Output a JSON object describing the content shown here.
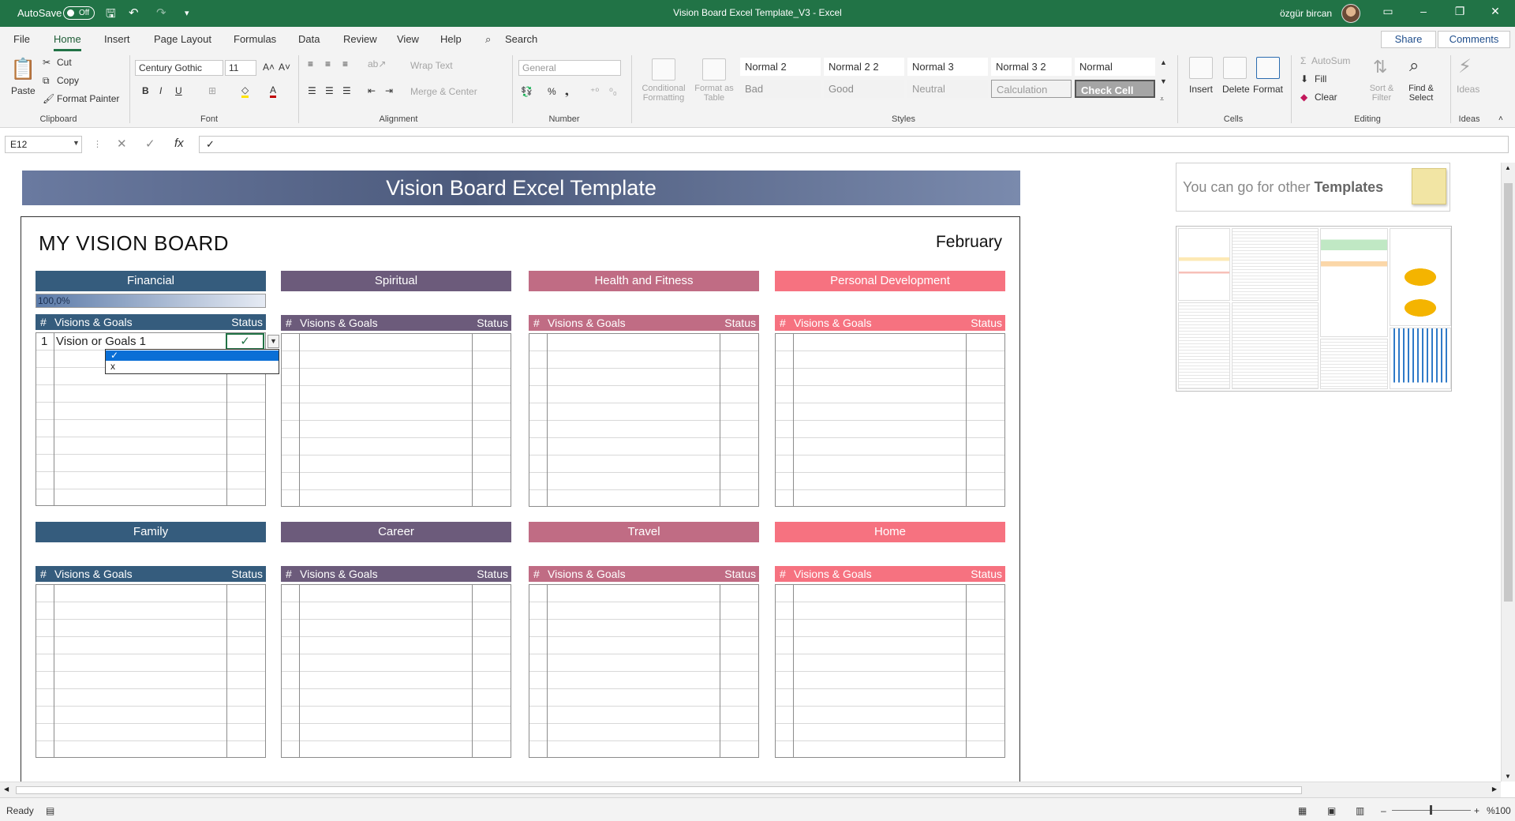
{
  "title_bar": {
    "autosave_label": "AutoSave",
    "autosave_state": "Off",
    "document_title": "Vision Board Excel Template_V3  -  Excel",
    "user_name": "özgür bircan"
  },
  "ribbon_tabs": [
    "File",
    "Home",
    "Insert",
    "Page Layout",
    "Formulas",
    "Data",
    "Review",
    "View",
    "Help"
  ],
  "search_label": "Search",
  "share_label": "Share",
  "comments_label": "Comments",
  "ribbon": {
    "clipboard": {
      "paste": "Paste",
      "cut": "Cut",
      "copy": "Copy",
      "format_painter": "Format Painter",
      "label": "Clipboard"
    },
    "font": {
      "name": "Century Gothic",
      "size": "11",
      "label": "Font"
    },
    "alignment": {
      "wrap_text": "Wrap Text",
      "merge_center": "Merge & Center",
      "label": "Alignment"
    },
    "number": {
      "format": "General",
      "label": "Number"
    },
    "styles": {
      "conditional": "Conditional Formatting",
      "format_as_table": "Format as Table",
      "cells": [
        {
          "name": "Normal 2",
          "bg": "#ffffff",
          "color": "#333333"
        },
        {
          "name": "Normal 2 2",
          "bg": "#ffffff",
          "color": "#333333"
        },
        {
          "name": "Normal 3",
          "bg": "#ffffff",
          "color": "#333333"
        },
        {
          "name": "Normal 3 2",
          "bg": "#ffffff",
          "color": "#333333"
        },
        {
          "name": "Normal",
          "bg": "#ffffff",
          "color": "#333333"
        },
        {
          "name": "Bad",
          "bg": "#f2f2f2",
          "color": "#8a8a8a"
        },
        {
          "name": "Good",
          "bg": "#f2f2f2",
          "color": "#8a8a8a"
        },
        {
          "name": "Neutral",
          "bg": "#f2f2f2",
          "color": "#9a9a9a"
        },
        {
          "name": "Calculation",
          "bg": "#f2f2f2",
          "color": "#9a9a9a"
        },
        {
          "name": "Check Cell",
          "bg": "#a5a5a5",
          "color": "#ffffff"
        }
      ],
      "label": "Styles"
    },
    "cells": {
      "insert": "Insert",
      "delete": "Delete",
      "format": "Format",
      "label": "Cells"
    },
    "editing": {
      "autosum": "AutoSum",
      "fill": "Fill",
      "clear": "Clear",
      "sort_filter": "Sort & Filter",
      "find_select": "Find & Select",
      "label": "Editing"
    },
    "ideas": {
      "ideas": "Ideas",
      "label": "Ideas"
    }
  },
  "formula_bar": {
    "name_box": "E12",
    "value": "✓"
  },
  "sheet": {
    "banner": "Vision Board Excel Template",
    "board_title": "MY VISION BOARD",
    "month": "February",
    "other_templates_prefix": "You can go for other ",
    "other_templates_bold": "Templates",
    "categories": [
      {
        "name": "Financial",
        "color": "#355c7d",
        "progress": "100,0%"
      },
      {
        "name": "Spiritual",
        "color": "#6c5b7b"
      },
      {
        "name": "Health and Fitness",
        "color": "#c06c84"
      },
      {
        "name": "Personal Development",
        "color": "#f67280"
      },
      {
        "name": "Family",
        "color": "#355c7d"
      },
      {
        "name": "Career",
        "color": "#6c5b7b"
      },
      {
        "name": "Travel",
        "color": "#c06c84"
      },
      {
        "name": "Home",
        "color": "#f67280"
      }
    ],
    "column_headers": {
      "num": "#",
      "goals": "Visions & Goals",
      "status": "Status"
    },
    "first_row": {
      "num": "1",
      "text": "Vision or Goals 1",
      "status": "✓"
    },
    "dropdown_options": [
      "✓",
      "x"
    ]
  },
  "status_bar": {
    "ready": "Ready",
    "zoom": "%100"
  }
}
